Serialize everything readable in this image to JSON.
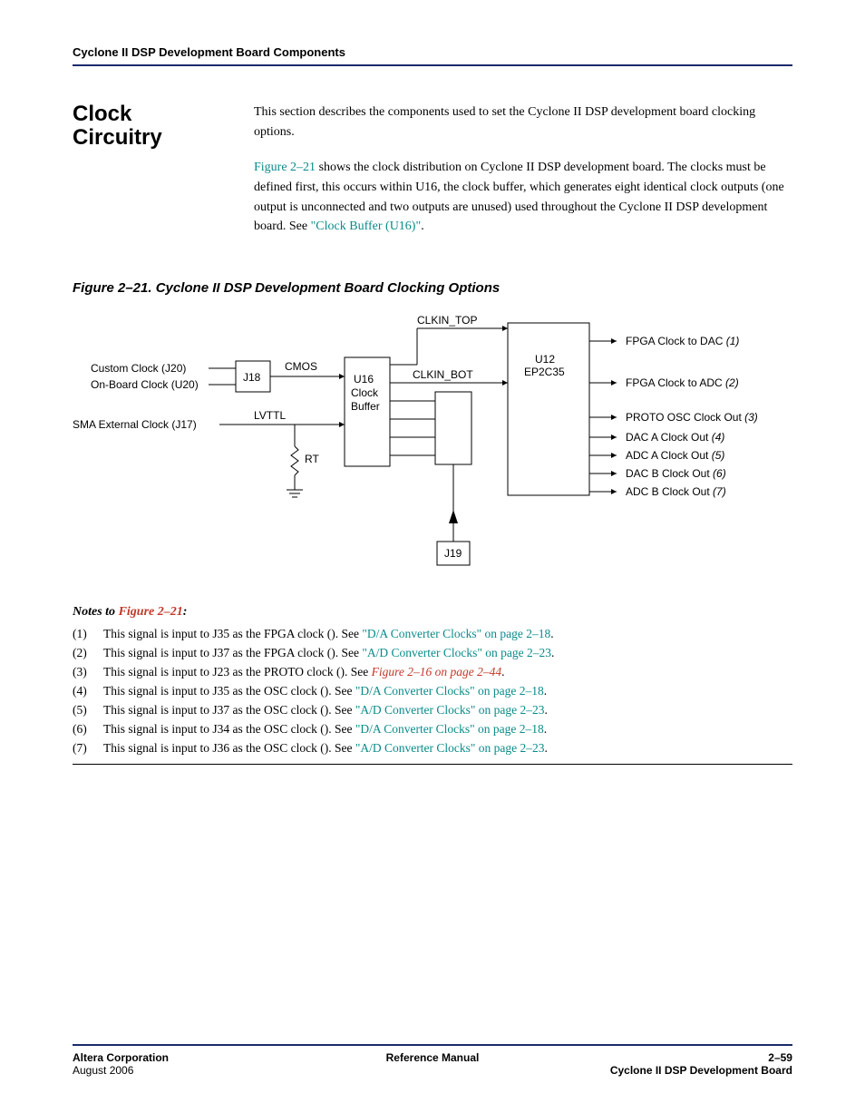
{
  "header": {
    "running_title": "Cyclone II DSP Development Board Components"
  },
  "section": {
    "title": "Clock Circuitry",
    "para1": "This section describes the components used to set the Cyclone II DSP development board clocking options.",
    "para2_prefix": "",
    "para2_link": "Figure 2–21",
    "para2_after": " shows the clock distribution on Cyclone II DSP development board. The clocks must be defined first, this occurs within U16, the clock buffer, which generates eight identical clock outputs (one output is unconnected and two outputs are unused) used throughout the Cyclone II DSP development board. See ",
    "para2_link2": "\"Clock Buffer (U16)\"",
    "para2_tail": "."
  },
  "figure": {
    "title": "Figure 2–21. Cyclone II DSP Development Board Clocking Options"
  },
  "diagram": {
    "inputs": {
      "custom": "Custom Clock (J20)",
      "onboard": "On-Board Clock (U20)",
      "sma": "SMA External Clock (J17)"
    },
    "j18": "J18",
    "cmos": "CMOS",
    "lvttl": "LVTTL",
    "rt": "RT",
    "u16_line1": "U16",
    "u16_line2": "Clock",
    "u16_line3": "Buffer",
    "clk_top": "CLKIN_TOP",
    "clk_bot": "CLKIN_BOT",
    "u12_line1": "U12",
    "u12_line2": "EP2C35",
    "j19": "J19",
    "outputs": [
      {
        "label": "FPGA Clock to DAC ",
        "note": "(1)"
      },
      {
        "label": "FPGA Clock to ADC ",
        "note": "(2)"
      },
      {
        "label": "PROTO OSC Clock Out ",
        "note": "(3)"
      },
      {
        "label": "DAC A Clock Out ",
        "note": "(4)"
      },
      {
        "label": "ADC A Clock Out ",
        "note": "(5)"
      },
      {
        "label": "DAC B Clock Out ",
        "note": "(6)"
      },
      {
        "label": "ADC B Clock Out ",
        "note": "(7)"
      }
    ]
  },
  "notes": {
    "title_before": "Notes to ",
    "title_link": "Figure 2–21",
    "title_after": ":",
    "items": [
      {
        "idx": "(1)",
        "pre": "This signal is input to J35 as the FPGA clock (",
        "mid": "). See ",
        "link": "\"D/A Converter Clocks\" on page 2–18",
        "tail": "."
      },
      {
        "idx": "(2)",
        "pre": "This signal is input to J37 as the FPGA clock (",
        "mid": "). See ",
        "link": "\"A/D Converter Clocks\" on page 2–23",
        "tail": "."
      },
      {
        "idx": "(3)",
        "pre": "This signal is input to J23 as the PROTO clock (",
        "mid": "). See ",
        "link": "Figure 2–16 on page 2–44",
        "tail": ".",
        "link_class": "red"
      },
      {
        "idx": "(4)",
        "pre": "This signal is input to J35 as the OSC clock (",
        "mid": "). See ",
        "link": "\"D/A Converter Clocks\" on page 2–18",
        "tail": "."
      },
      {
        "idx": "(5)",
        "pre": "This signal is input to J37 as the OSC clock (",
        "mid": "). See ",
        "link": "\"A/D Converter Clocks\" on page 2–23",
        "tail": "."
      },
      {
        "idx": "(6)",
        "pre": "This signal is input to J34 as the OSC clock (",
        "mid": "). See ",
        "link": "\"D/A Converter Clocks\" on page 2–18",
        "tail": "."
      },
      {
        "idx": "(7)",
        "pre": "This signal is input to J36 as the OSC clock (",
        "mid": "). See ",
        "link": "\"A/D Converter Clocks\" on page 2–23",
        "tail": "."
      }
    ]
  },
  "footer": {
    "left_line1": "Altera Corporation",
    "left_line2": "August 2006",
    "mid": "Reference Manual",
    "right_line1": "2–59",
    "right_line2": "Cyclone II DSP Development Board"
  }
}
